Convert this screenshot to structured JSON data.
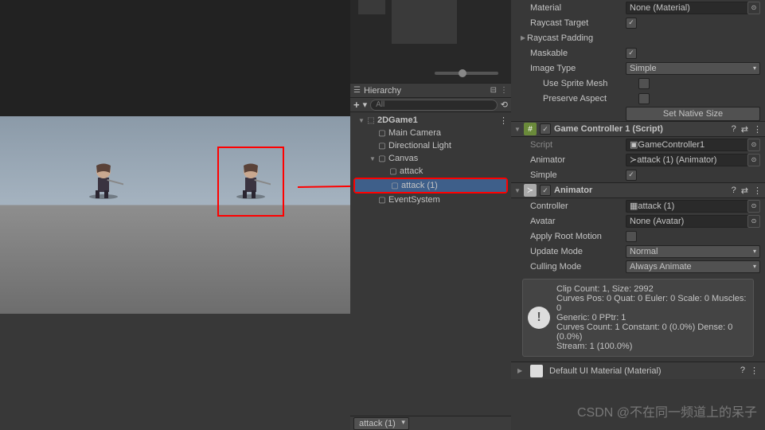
{
  "hierarchy": {
    "panel_title": "Hierarchy",
    "search_placeholder": "All",
    "scene": "2DGame1",
    "items": [
      {
        "label": "Main Camera",
        "depth": 1
      },
      {
        "label": "Directional Light",
        "depth": 1
      },
      {
        "label": "Canvas",
        "depth": 1,
        "fold": true
      },
      {
        "label": "attack",
        "depth": 2
      },
      {
        "label": "attack (1)",
        "depth": 2,
        "selected": true
      },
      {
        "label": "EventSystem",
        "depth": 1
      }
    ],
    "bottom_dd": "attack (1)"
  },
  "inspector": {
    "material": {
      "label": "Material",
      "value": "None (Material)"
    },
    "raycast_target": {
      "label": "Raycast Target",
      "checked": true
    },
    "raycast_padding": {
      "label": "Raycast Padding"
    },
    "maskable": {
      "label": "Maskable",
      "checked": true
    },
    "image_type": {
      "label": "Image Type",
      "value": "Simple"
    },
    "use_sprite_mesh": {
      "label": "Use Sprite Mesh",
      "checked": false
    },
    "preserve_aspect": {
      "label": "Preserve Aspect",
      "checked": false
    },
    "set_native": "Set Native Size",
    "game_controller": {
      "title": "Game Controller 1 (Script)",
      "script": {
        "label": "Script",
        "value": "GameController1"
      },
      "animator": {
        "label": "Animator",
        "value": "attack (1) (Animator)"
      },
      "simple": {
        "label": "Simple",
        "checked": true
      }
    },
    "animator": {
      "title": "Animator",
      "controller": {
        "label": "Controller",
        "value": "attack (1)"
      },
      "avatar": {
        "label": "Avatar",
        "value": "None (Avatar)"
      },
      "apply_root": {
        "label": "Apply Root Motion",
        "checked": false
      },
      "update_mode": {
        "label": "Update Mode",
        "value": "Normal"
      },
      "culling_mode": {
        "label": "Culling Mode",
        "value": "Always Animate"
      },
      "info_lines": [
        "Clip Count: 1, Size: 2992",
        "Curves Pos: 0 Quat: 0 Euler: 0 Scale: 0 Muscles: 0",
        "Generic: 0 PPtr: 1",
        "Curves Count: 1 Constant: 0 (0.0%) Dense: 0 (0.0%)",
        "Stream: 1 (100.0%)"
      ]
    },
    "default_material": "Default UI Material (Material)"
  },
  "watermark": "CSDN @不在同一频道上的呆子"
}
